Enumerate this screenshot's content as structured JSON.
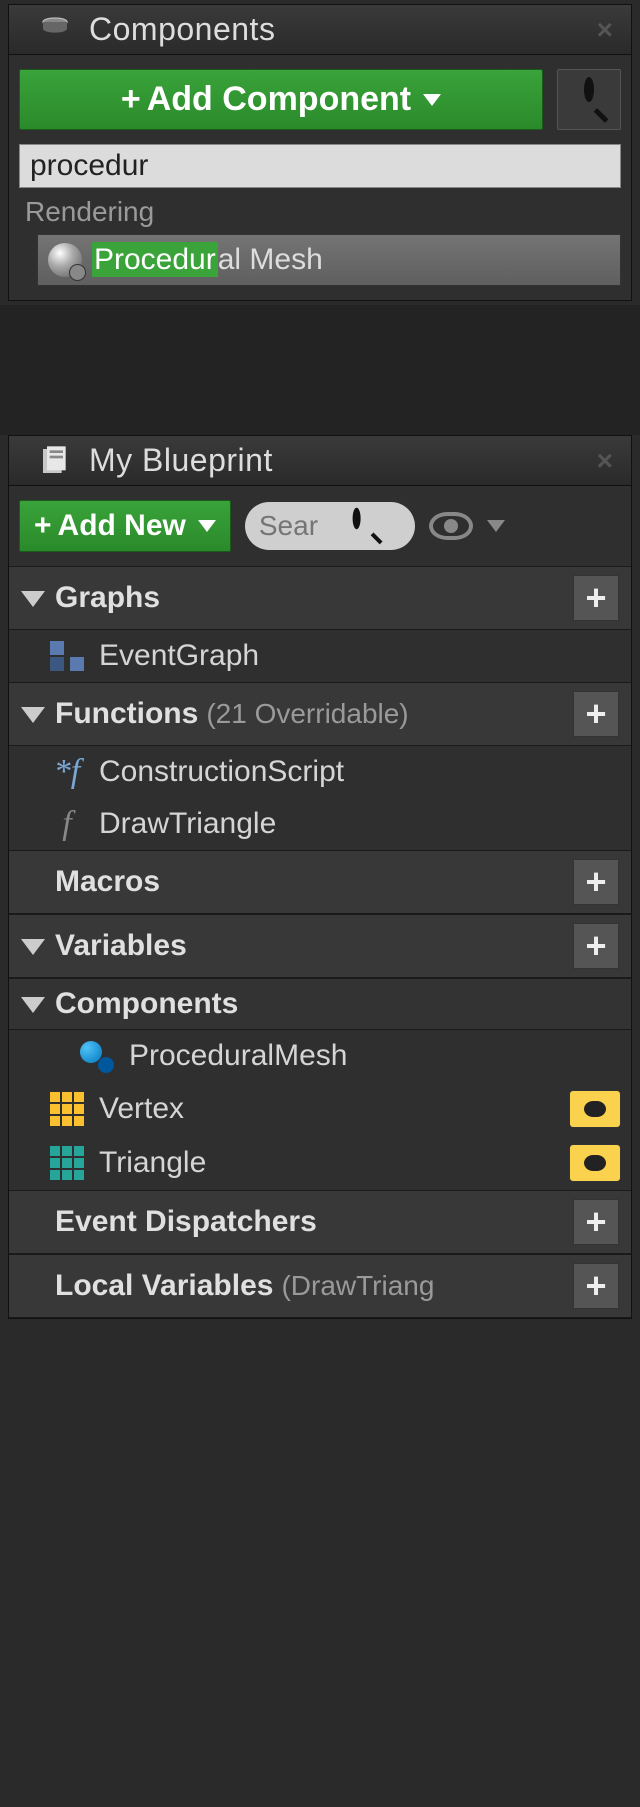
{
  "components_panel": {
    "title": "Components",
    "add_button_label": "Add Component",
    "search_value": "procedur",
    "dropdown_category": "Rendering",
    "result_highlight": "Procedur",
    "result_rest": "al Mesh"
  },
  "blueprint_panel": {
    "title": "My Blueprint",
    "add_button_label": "Add New",
    "search_placeholder": "Sear",
    "categories": {
      "graphs": {
        "label": "Graphs"
      },
      "functions": {
        "label": "Functions",
        "sub": "(21 Overridable)"
      },
      "macros": {
        "label": "Macros"
      },
      "variables": {
        "label": "Variables"
      },
      "components": {
        "label": "Components"
      },
      "event_dispatchers": {
        "label": "Event Dispatchers"
      },
      "local_variables": {
        "label": "Local Variables",
        "sub": "(DrawTriang"
      }
    },
    "items": {
      "event_graph": "EventGraph",
      "construction_script": "ConstructionScript",
      "draw_triangle": "DrawTriangle",
      "procedural_mesh": "ProceduralMesh",
      "vertex": "Vertex",
      "triangle": "Triangle"
    }
  }
}
